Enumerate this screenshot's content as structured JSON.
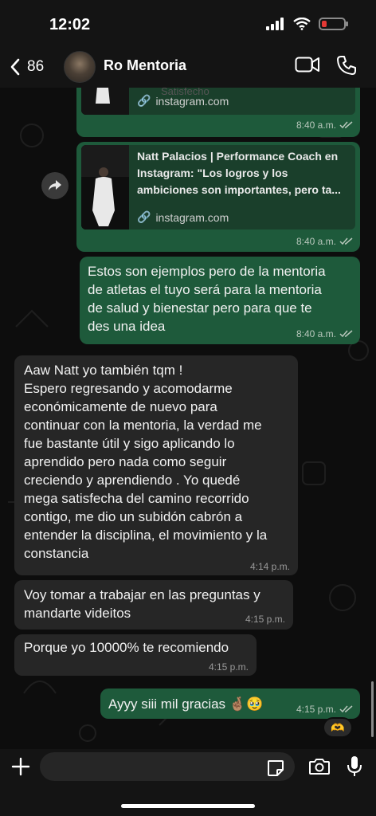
{
  "status_bar": {
    "time": "12:02",
    "battery_color": "#e53935"
  },
  "header": {
    "back_count": "86",
    "contact_name": "Ro Mentoria"
  },
  "messages": [
    {
      "type": "link",
      "direction": "outgoing",
      "title_partial": "Satisfecho",
      "host": "instagram.com",
      "time": "8:40 a.m."
    },
    {
      "type": "link",
      "direction": "outgoing",
      "title": "Natt Palacios | Performance Coach en Instagram: \"Los logros y los ambiciones son importantes, pero ta...",
      "title_lines": [
        "Natt Palacios | Performance Coach en",
        "Instagram: \"Los logros y los",
        "ambiciones son importantes, pero ta..."
      ],
      "host": "instagram.com",
      "time": "8:40 a.m."
    },
    {
      "type": "text",
      "direction": "outgoing",
      "lines": [
        "Estos son ejemplos pero de la mentoria",
        "de atletas el tuyo será para la mentoria",
        "de salud y bienestar pero para que te",
        "des una idea"
      ],
      "time": "8:40 a.m."
    },
    {
      "type": "text",
      "direction": "incoming",
      "lines": [
        "Aaw Natt yo también tqm !",
        "Espero regresando y acomodarme",
        "económicamente de nuevo para",
        "continuar con la mentoria, la verdad me",
        "fue bastante útil y sigo aplicando lo",
        "aprendido pero nada como seguir",
        "creciendo y aprendiendo . Yo quedé",
        "mega satisfecha del camino recorrido",
        "contigo, me dio un subidón cabrón a",
        "entender la disciplina, el movimiento y la",
        "constancia"
      ],
      "time": "4:14 p.m."
    },
    {
      "type": "text",
      "direction": "incoming",
      "lines": [
        "Voy tomar a trabajar en las preguntas y",
        "mandarte videitos"
      ],
      "time": "4:15 p.m."
    },
    {
      "type": "text",
      "direction": "incoming",
      "lines": [
        "Porque yo 10000% te recomiendo"
      ],
      "time": "4:15 p.m."
    },
    {
      "type": "text",
      "direction": "outgoing",
      "lines": [
        "Ayyy siii mil gracias 🤞🏽🥹"
      ],
      "time": "4:15 p.m.",
      "reaction": "🫶"
    }
  ],
  "thumb_caption": "Satisfecho",
  "composer": {
    "placeholder": ""
  },
  "colors": {
    "outgoing": "#1e5a3b",
    "incoming": "#262626",
    "link_card": "#1a3f2b",
    "read_ticks": "#b8c7bc"
  }
}
